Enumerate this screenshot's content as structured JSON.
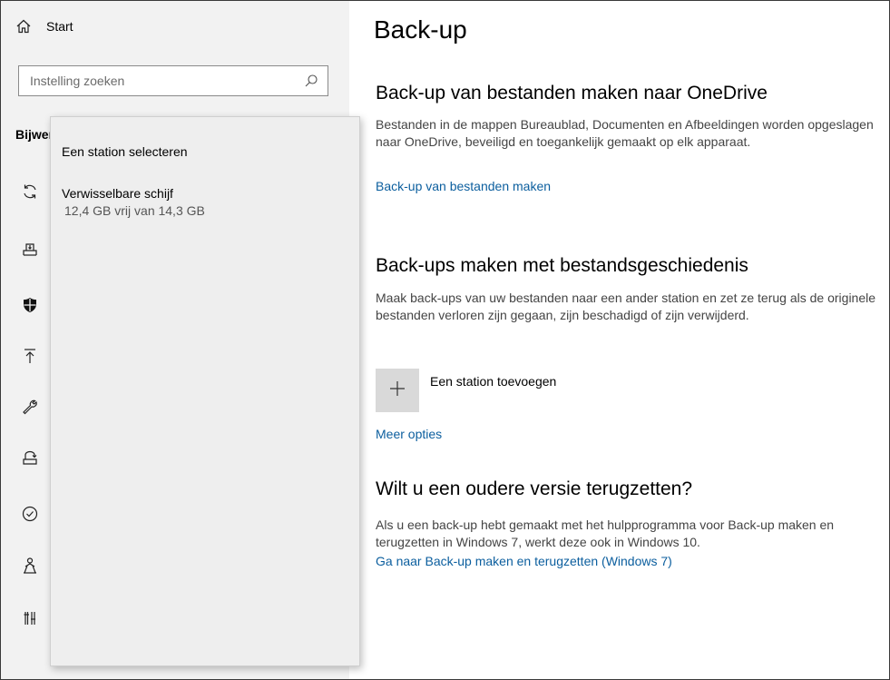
{
  "sidebar": {
    "home_label": "Start",
    "search_placeholder": "Instelling zoeken",
    "section_label": "Bijwerken en beveiliging",
    "icons": [
      "sync-icon",
      "delivery-optimization-icon",
      "windows-security-shield-icon",
      "backup-arrow-icon",
      "troubleshoot-wrench-icon",
      "recovery-icon",
      "activation-icon",
      "find-my-device-icon",
      "developers-icon"
    ]
  },
  "flyout": {
    "title": "Een station selecteren",
    "drive_name": "Verwisselbare schijf",
    "drive_detail": "12,4 GB  vrij van 14,3 GB"
  },
  "main": {
    "title": "Back-up",
    "onedrive": {
      "heading": "Back-up van bestanden maken naar OneDrive",
      "body": "Bestanden in de mappen Bureaublad, Documenten en Afbeeldingen worden opgeslagen naar OneDrive, beveiligd en toegankelijk gemaakt op elk apparaat.",
      "link": "Back-up van bestanden maken"
    },
    "history": {
      "heading": "Back-ups maken met bestandsgeschiedenis",
      "body": "Maak back-ups van uw bestanden naar een ander station en zet ze terug als de originele bestanden verloren zijn gegaan, zijn beschadigd of zijn verwijderd.",
      "add_drive_label": "Een station toevoegen",
      "more_options": "Meer opties"
    },
    "older": {
      "heading": "Wilt u een oudere versie terugzetten?",
      "body": "Als u een back-up hebt gemaakt met het hulpprogramma voor Back-up maken en terugzetten in Windows 7, werkt deze ook in Windows 10.",
      "link": "Ga naar Back-up maken en terugzetten (Windows 7)"
    }
  },
  "colors": {
    "link": "#0b5e9e",
    "sidebar_bg": "#f2f2f2",
    "flyout_bg": "#eeeeee",
    "tile_bg": "#d9d9d9"
  }
}
